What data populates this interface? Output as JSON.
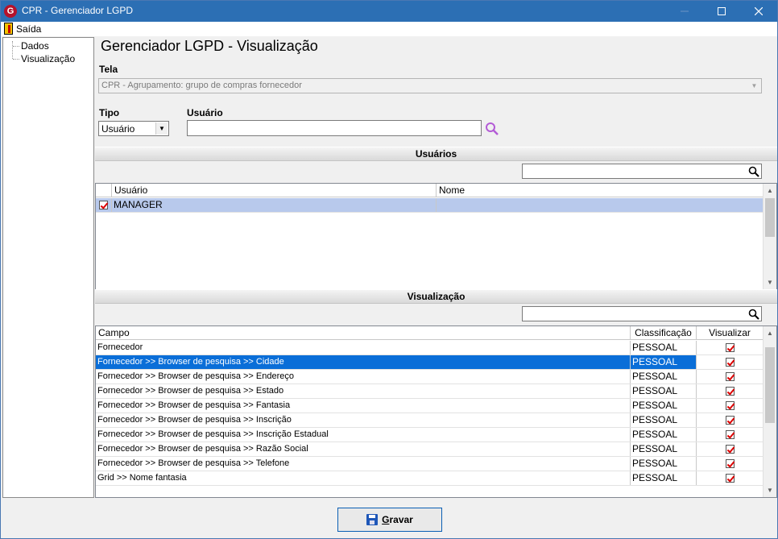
{
  "window": {
    "title": "CPR - Gerenciador LGPD",
    "app_icon": "G"
  },
  "menu": {
    "exit_label": "Saída"
  },
  "tree": {
    "items": [
      "Dados",
      "Visualização"
    ]
  },
  "page": {
    "heading": "Gerenciador LGPD - Visualização",
    "tela_label": "Tela",
    "tela_value": "CPR - Agrupamento: grupo de compras fornecedor",
    "tipo_label": "Tipo",
    "tipo_value": "Usuário",
    "usuario_label": "Usuário",
    "usuario_value": ""
  },
  "users_section": {
    "title": "Usuários",
    "search_value": "",
    "columns": [
      "Usuário",
      "Nome"
    ],
    "rows": [
      {
        "checked": true,
        "usuario": "MANAGER",
        "nome": ""
      }
    ]
  },
  "view_section": {
    "title": "Visualização",
    "search_value": "",
    "columns": [
      "Campo",
      "Classificação",
      "Visualizar"
    ],
    "rows": [
      {
        "campo": "Fornecedor",
        "classificacao": "PESSOAL",
        "visualizar": true
      },
      {
        "campo": "Fornecedor >> Browser de pesquisa >> Cidade",
        "classificacao": "PESSOAL",
        "visualizar": true
      },
      {
        "campo": "Fornecedor >> Browser de pesquisa >> Endereço",
        "classificacao": "PESSOAL",
        "visualizar": true
      },
      {
        "campo": "Fornecedor >> Browser de pesquisa >> Estado",
        "classificacao": "PESSOAL",
        "visualizar": true
      },
      {
        "campo": "Fornecedor >> Browser de pesquisa >> Fantasia",
        "classificacao": "PESSOAL",
        "visualizar": true
      },
      {
        "campo": "Fornecedor >> Browser de pesquisa >> Inscrição",
        "classificacao": "PESSOAL",
        "visualizar": true
      },
      {
        "campo": "Fornecedor >> Browser de pesquisa >> Inscrição Estadual",
        "classificacao": "PESSOAL",
        "visualizar": true
      },
      {
        "campo": "Fornecedor >> Browser de pesquisa >> Razão Social",
        "classificacao": "PESSOAL",
        "visualizar": true
      },
      {
        "campo": "Fornecedor >> Browser de pesquisa >> Telefone",
        "classificacao": "PESSOAL",
        "visualizar": true
      },
      {
        "campo": "Grid >> Nome fantasia",
        "classificacao": "PESSOAL",
        "visualizar": true
      }
    ],
    "selected_row": 1
  },
  "footer": {
    "save_label_first": "G",
    "save_label_rest": "ravar"
  },
  "colors": {
    "titlebar": "#2c6fb4",
    "selection": "#0a6ed8",
    "check": "#dd0000"
  }
}
